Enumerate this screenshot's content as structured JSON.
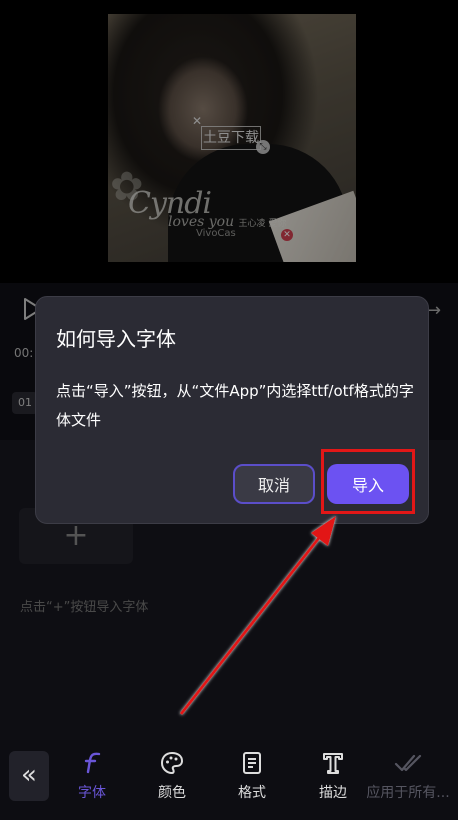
{
  "preview": {
    "overlay_text": "土豆下载",
    "brand_logo": "Cyndi",
    "brand_sub": "loves you",
    "brand_small": "王心凌 愛你",
    "watermark": "VivoCas"
  },
  "editor": {
    "time": "00:",
    "track_label": "01",
    "add_font_symbol": "+",
    "add_font_hint": "点击“+”按钮导入字体"
  },
  "dialog": {
    "title": "如何导入字体",
    "body": "点击“导入”按钮，从“文件App”内选择ttf/otf格式的字体文件",
    "cancel_label": "取消",
    "import_label": "导入"
  },
  "toolbar": {
    "back_icon": "«",
    "items": [
      {
        "label": "字体",
        "icon": "font-icon"
      },
      {
        "label": "颜色",
        "icon": "palette-icon"
      },
      {
        "label": "格式",
        "icon": "document-icon"
      },
      {
        "label": "描边",
        "icon": "text-stroke-icon"
      },
      {
        "label": "应用于所有...",
        "icon": "double-check-icon"
      }
    ]
  },
  "colors": {
    "accent": "#6c52f2",
    "active_tab": "#6a56d8",
    "highlight": "#e21717",
    "dialog_bg": "#2b2b34"
  }
}
